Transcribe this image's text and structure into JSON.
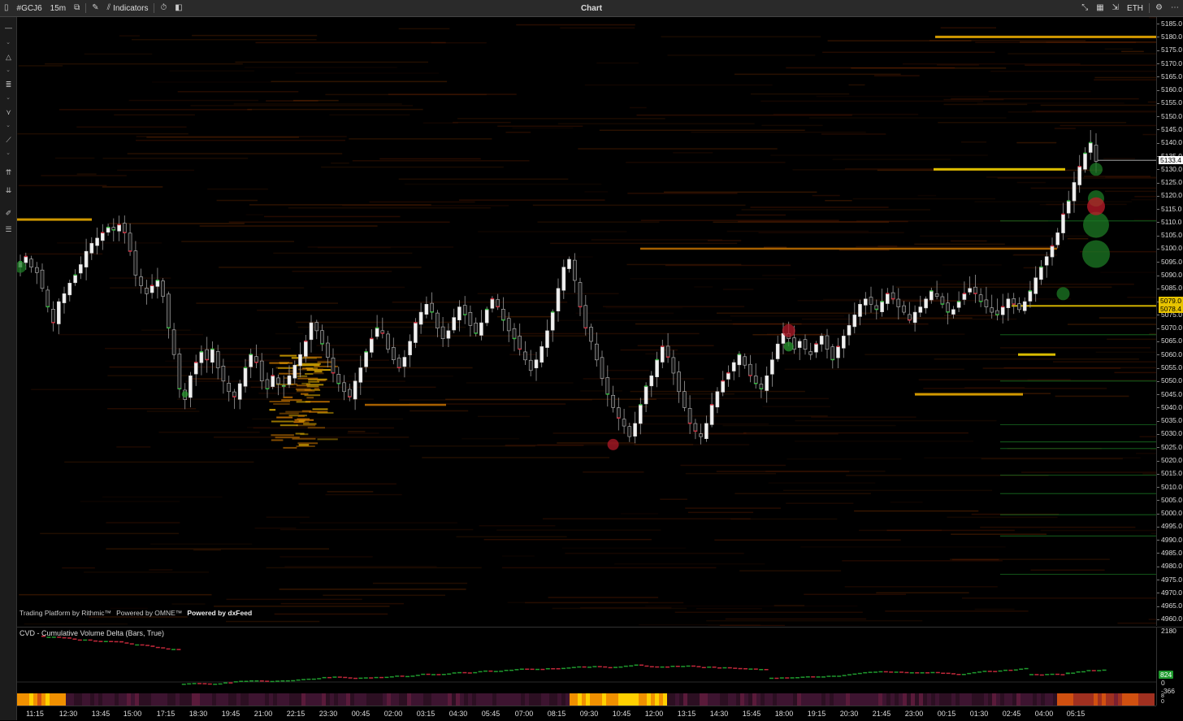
{
  "toolbar": {
    "symbol": "#GCJ6",
    "timeframe": "15m",
    "indicators_label": "Indicators",
    "window_title": "Chart",
    "session": "ETH"
  },
  "credits": {
    "rithmic": "Trading Platform by Rithmic™",
    "omne": "Powered by OMNE™",
    "dxfeed": "Powered by dxFeed"
  },
  "price_axis": {
    "labels": [
      "5185.0",
      "5180.0",
      "5175.0",
      "5170.0",
      "5165.0",
      "5160.0",
      "5155.0",
      "5150.0",
      "5145.0",
      "5140.0",
      "5135.0",
      "5130.0",
      "5125.0",
      "5120.0",
      "5115.0",
      "5110.0",
      "5105.0",
      "5100.0",
      "5095.0",
      "5090.0",
      "5085.0",
      "5080.0",
      "5075.0",
      "5070.0",
      "5065.0",
      "5060.0",
      "5055.0",
      "5050.0",
      "5045.0",
      "5040.0",
      "5035.0",
      "5030.0",
      "5025.0",
      "5020.0",
      "5015.0",
      "5010.0",
      "5005.0",
      "5000.0",
      "4995.0",
      "4990.0",
      "4985.0",
      "4980.0",
      "4975.0",
      "4970.0",
      "4965.0",
      "4960.0"
    ],
    "last_price_label": "5133.4",
    "marker_label": "5079.0",
    "marker_label_2": "5078.4",
    "colors": {
      "last_price": "#ffffff",
      "marker": "#e8c400"
    }
  },
  "cvd": {
    "title": "CVD - Cumulative Volume Delta (Bars, True)",
    "axis_top": "2180",
    "axis_value": "824",
    "axis_zero": "0",
    "axis_low": "-366",
    "heat_axis_1": "8",
    "heat_axis_2": "0",
    "colors": {
      "up": "#1f9a2e",
      "down": "#c0283a"
    }
  },
  "time_axis": {
    "labels": [
      "11:15",
      "12:30",
      "13:45",
      "15:00",
      "17:15",
      "18:30",
      "19:45",
      "21:00",
      "22:15",
      "23:30",
      "00:45",
      "02:00",
      "03:15",
      "04:30",
      "05:45",
      "07:00",
      "08:15",
      "09:30",
      "10:45",
      "12:00",
      "13:15",
      "14:30",
      "15:45",
      "18:00",
      "19:15",
      "20:30",
      "21:45",
      "23:00",
      "00:15",
      "01:30",
      "02:45",
      "04:00",
      "05:15"
    ]
  },
  "chart_data": {
    "type": "candlestick",
    "symbol": "#GCJ6",
    "interval": "15m",
    "ylim": [
      4957.5,
      5187.5
    ],
    "y_ticks_step": 5,
    "key_levels": [
      5180.0,
      5130.0,
      5111.0,
      5100.0,
      5078.4,
      5060.0,
      5045.0,
      5041.0
    ],
    "last_price": 5133.4,
    "closes": [
      5095,
      5097,
      5093,
      5091,
      5085,
      5078,
      5072,
      5080,
      5083,
      5087,
      5090,
      5094,
      5099,
      5102,
      5104,
      5106,
      5108,
      5107,
      5109,
      5106,
      5099,
      5090,
      5086,
      5083,
      5086,
      5088,
      5082,
      5070,
      5060,
      5047,
      5043,
      5052,
      5057,
      5061,
      5058,
      5062,
      5055,
      5050,
      5046,
      5044,
      5049,
      5055,
      5060,
      5057,
      5050,
      5047,
      5052,
      5049,
      5048,
      5052,
      5056,
      5060,
      5065,
      5072,
      5069,
      5064,
      5059,
      5053,
      5049,
      5046,
      5044,
      5050,
      5055,
      5061,
      5066,
      5070,
      5068,
      5062,
      5058,
      5055,
      5059,
      5065,
      5072,
      5076,
      5079,
      5076,
      5070,
      5066,
      5069,
      5074,
      5078,
      5075,
      5071,
      5068,
      5072,
      5077,
      5081,
      5078,
      5073,
      5069,
      5066,
      5062,
      5058,
      5054,
      5058,
      5063,
      5069,
      5076,
      5085,
      5093,
      5096,
      5088,
      5078,
      5070,
      5065,
      5058,
      5051,
      5045,
      5040,
      5036,
      5033,
      5029,
      5034,
      5041,
      5048,
      5052,
      5058,
      5063,
      5059,
      5053,
      5046,
      5040,
      5034,
      5031,
      5029,
      5034,
      5041,
      5046,
      5050,
      5053,
      5057,
      5060,
      5056,
      5052,
      5049,
      5047,
      5052,
      5058,
      5064,
      5068,
      5066,
      5062,
      5065,
      5062,
      5060,
      5064,
      5067,
      5062,
      5058,
      5063,
      5067,
      5071,
      5075,
      5079,
      5081,
      5079,
      5077,
      5080,
      5083,
      5081,
      5078,
      5076,
      5073,
      5076,
      5078,
      5081,
      5084,
      5082,
      5079,
      5076,
      5077,
      5080,
      5083,
      5085,
      5083,
      5080,
      5078,
      5076,
      5075,
      5078,
      5081,
      5079,
      5077,
      5080,
      5084,
      5089,
      5093,
      5097,
      5101,
      5106,
      5113,
      5118,
      5125,
      5131,
      5136,
      5140,
      5133
    ]
  }
}
